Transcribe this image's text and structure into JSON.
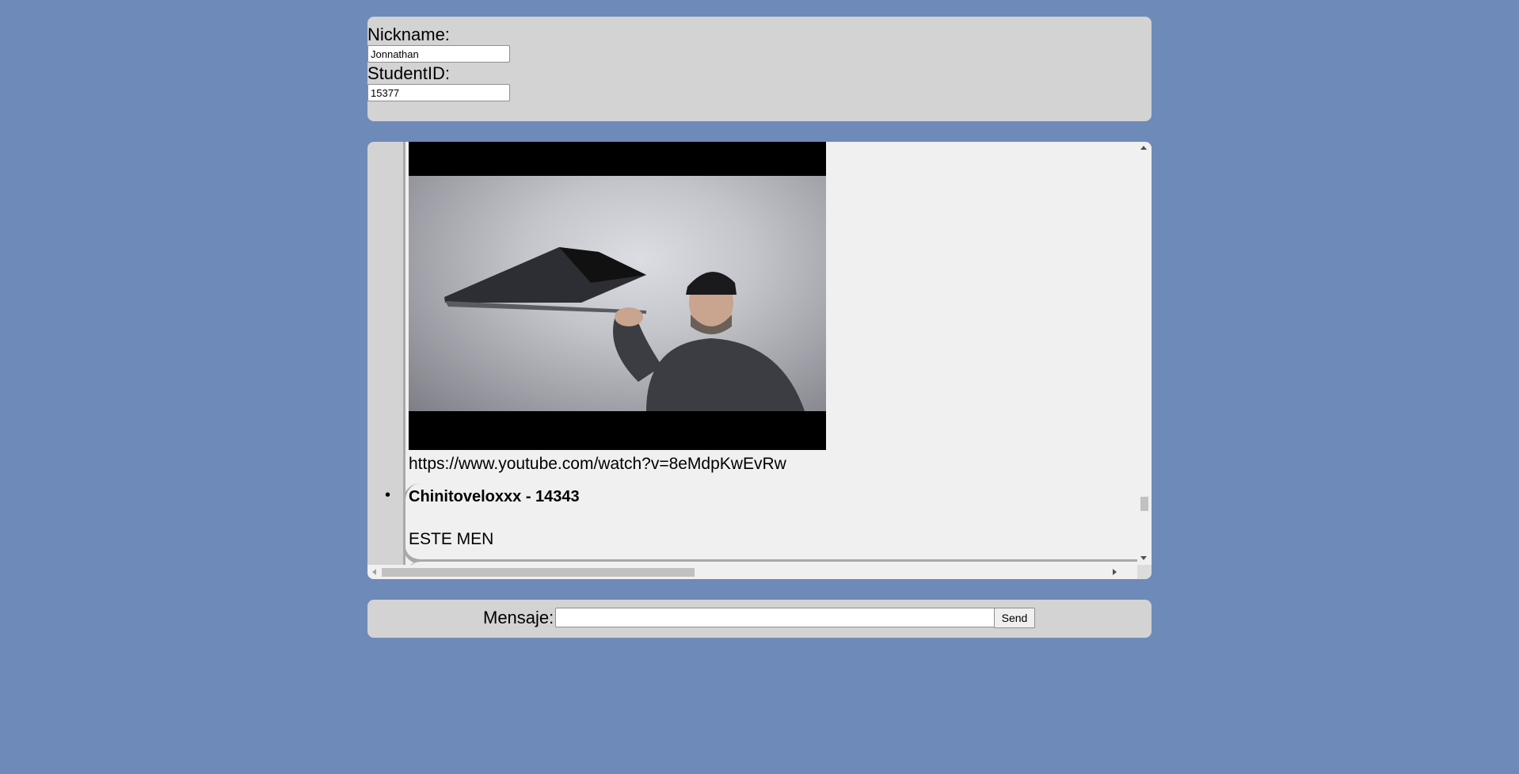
{
  "profile": {
    "nickname_label": "Nickname:",
    "nickname_value": "Jonnathan",
    "student_id_label": "StudentID:",
    "student_id_value": "15377"
  },
  "chat": {
    "messages": [
      {
        "author": "",
        "media": "video-thumbnail",
        "text": "https://www.youtube.com/watch?v=8eMdpKwEvRw"
      },
      {
        "author": "Chinitoveloxxx - 14343",
        "text": "ESTE MEN"
      }
    ]
  },
  "compose": {
    "label": "Mensaje:",
    "value": "",
    "send_label": "Send"
  },
  "colors": {
    "background": "#6e8ab9",
    "panel": "#d3d3d3",
    "message_bubble": "#f0f0f0",
    "bubble_border": "#a9a9a9"
  }
}
